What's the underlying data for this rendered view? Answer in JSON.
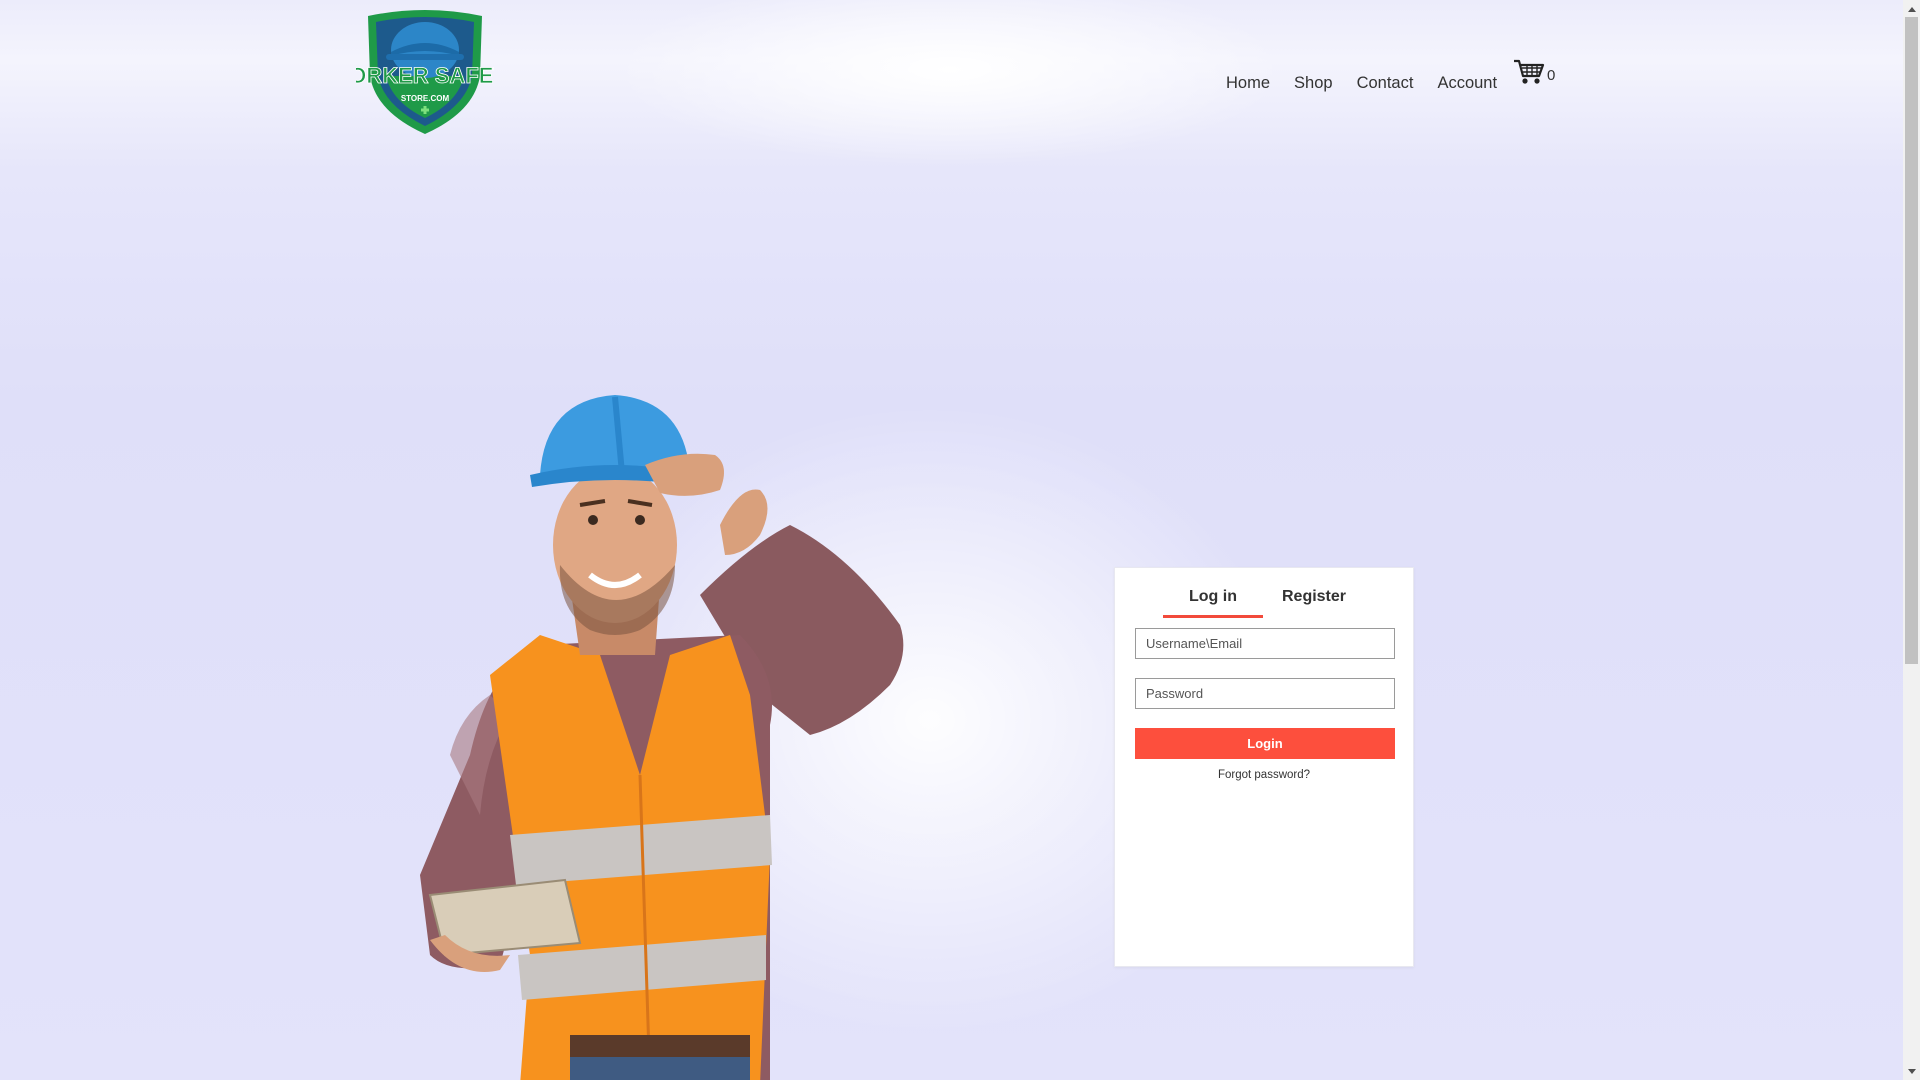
{
  "nav": {
    "items": [
      {
        "label": "Home"
      },
      {
        "label": "Shop"
      },
      {
        "label": "Contact"
      },
      {
        "label": "Account"
      }
    ],
    "cart_count": "0"
  },
  "logo": {
    "alt": "Worker Safety Store logo"
  },
  "login": {
    "tabs": [
      {
        "label": "Log in"
      },
      {
        "label": "Register"
      }
    ],
    "username_placeholder": "Username\\Email",
    "password_placeholder": "Password",
    "login_button": "Login",
    "forgot_link": "Forgot password?"
  },
  "colors": {
    "accent": "#fd4f3d",
    "logo_green": "#1f9a48",
    "logo_blue": "#1d5a8c"
  }
}
